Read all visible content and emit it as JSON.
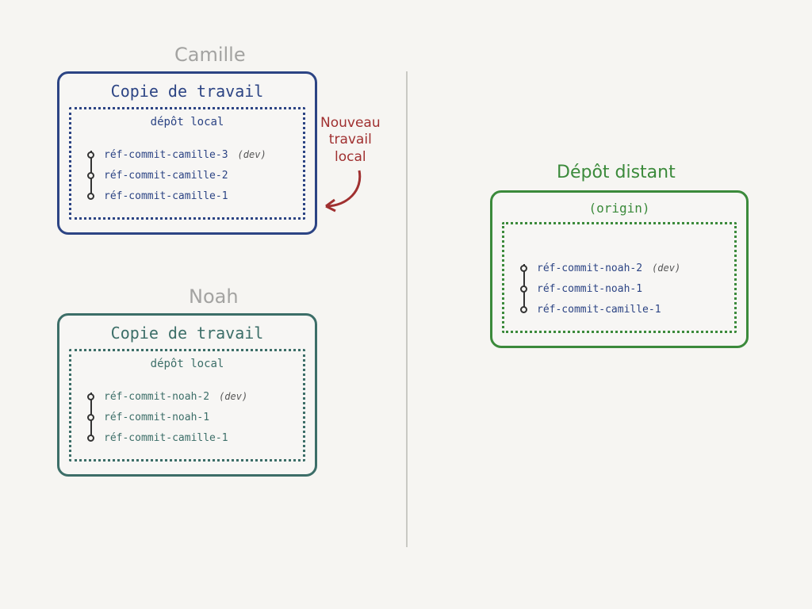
{
  "camille": {
    "name": "Camille",
    "working_copy_title": "Copie de travail",
    "local_repo_title": "dépôt local",
    "commits": [
      {
        "ref": "réf-commit-camille-3",
        "tag": "(dev)"
      },
      {
        "ref": "réf-commit-camille-2",
        "tag": ""
      },
      {
        "ref": "réf-commit-camille-1",
        "tag": ""
      }
    ],
    "color": "#2c4484"
  },
  "noah": {
    "name": "Noah",
    "working_copy_title": "Copie de travail",
    "local_repo_title": "dépôt local",
    "commits": [
      {
        "ref": "réf-commit-noah-2",
        "tag": "(dev)"
      },
      {
        "ref": "réf-commit-noah-1",
        "tag": ""
      },
      {
        "ref": "réf-commit-camille-1",
        "tag": ""
      }
    ],
    "color": "#3c6e68"
  },
  "remote": {
    "title": "Dépôt distant",
    "origin_label": "(origin)",
    "commits": [
      {
        "ref": "réf-commit-noah-2",
        "tag": "(dev)"
      },
      {
        "ref": "réf-commit-noah-1",
        "tag": ""
      },
      {
        "ref": "réf-commit-camille-1",
        "tag": ""
      }
    ],
    "color": "#3b8a3b"
  },
  "callout": {
    "line1": "Nouveau",
    "line2": "travail",
    "line3": "local",
    "color": "#a03030"
  }
}
